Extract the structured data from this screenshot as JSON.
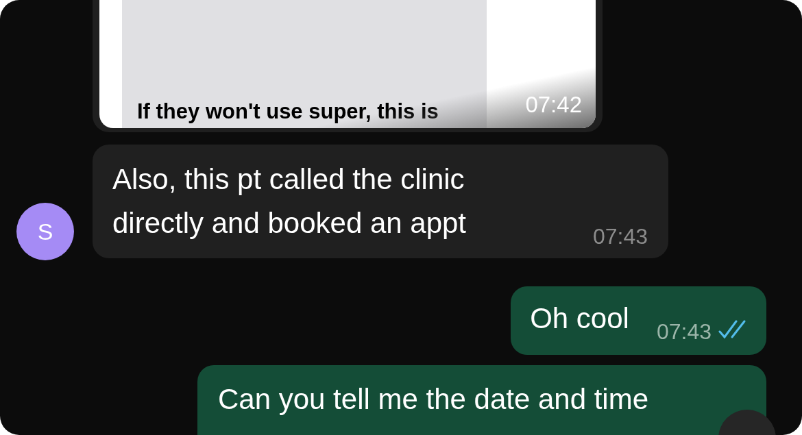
{
  "messages": [
    {
      "kind": "image",
      "caption": "If they won't use super, this is",
      "time": "07:42"
    },
    {
      "kind": "received",
      "sender_initial": "S",
      "lines": [
        "Also, this pt called the clinic",
        "directly and booked an appt"
      ],
      "time": "07:43"
    },
    {
      "kind": "sent",
      "text": "Oh cool",
      "time": "07:43",
      "read": true
    },
    {
      "kind": "sent",
      "text": "Can you tell me the date and time"
    }
  ]
}
